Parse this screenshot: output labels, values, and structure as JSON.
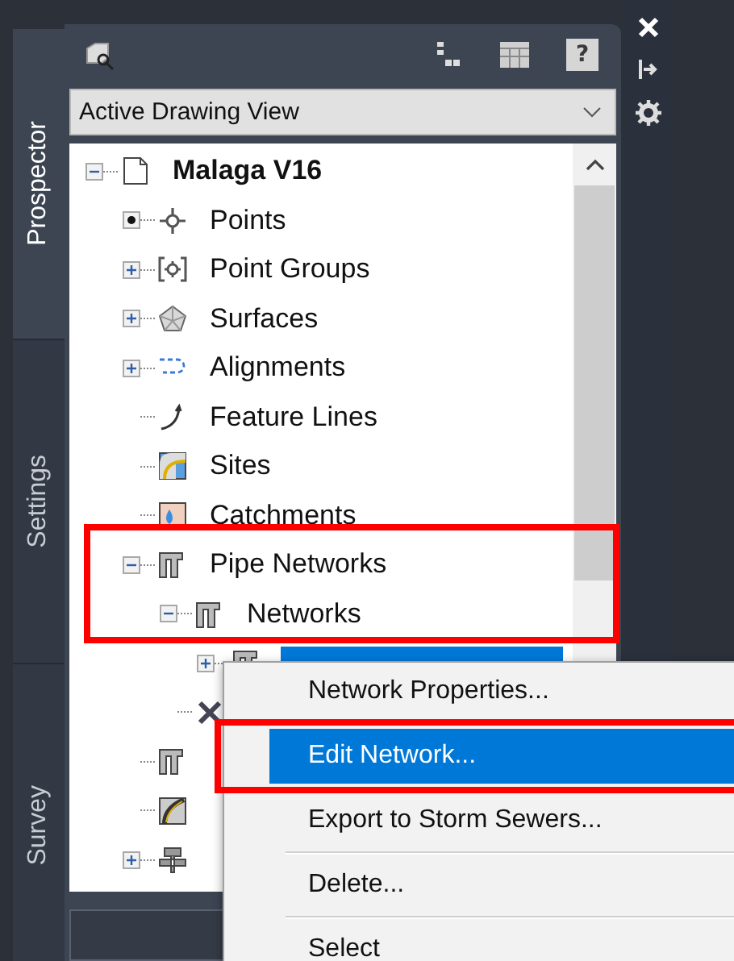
{
  "side_tabs": [
    {
      "label": "Prospector",
      "selected": true
    },
    {
      "label": "Settings",
      "selected": false
    },
    {
      "label": "Survey",
      "selected": false
    }
  ],
  "toolbar": {
    "help_label": "?"
  },
  "view_select": {
    "value": "Active Drawing View"
  },
  "tree": {
    "label": "Malaga V16",
    "kind": "drawing",
    "expanded": true,
    "selected": false,
    "children": [
      {
        "label": "Points",
        "kind": "point",
        "selected": false
      },
      {
        "label": "Point Groups",
        "kind": "point-group",
        "expanded": false,
        "selected": false
      },
      {
        "label": "Surfaces",
        "kind": "surface",
        "expanded": false,
        "selected": false
      },
      {
        "label": "Alignments",
        "kind": "alignment",
        "expanded": false,
        "selected": false
      },
      {
        "label": "Feature Lines",
        "kind": "feature-line",
        "selected": false
      },
      {
        "label": "Sites",
        "kind": "site",
        "selected": false
      },
      {
        "label": "Catchments",
        "kind": "catchment",
        "selected": false
      },
      {
        "label": "Pipe Networks",
        "kind": "pipe",
        "expanded": true,
        "selected": false,
        "children": [
          {
            "label": "Networks",
            "kind": "pipe",
            "expanded": true,
            "selected": false,
            "children": [
              {
                "kind": "pipe",
                "expanded": false,
                "selected": true
              }
            ]
          },
          {
            "kind": "fitting"
          }
        ]
      },
      {
        "kind": "pipe",
        "selected": false
      },
      {
        "kind": "corridor",
        "selected": false
      },
      {
        "kind": "assembly",
        "expanded": false,
        "selected": false
      }
    ]
  },
  "context_menu": [
    {
      "label": "Network Properties...",
      "selected": false
    },
    {
      "label": "Edit Network...",
      "selected": true
    },
    {
      "label": "Export to Storm Sewers...",
      "selected": false
    },
    {
      "label": "Delete...",
      "selected": false
    },
    {
      "label": "Select",
      "selected": false
    }
  ]
}
